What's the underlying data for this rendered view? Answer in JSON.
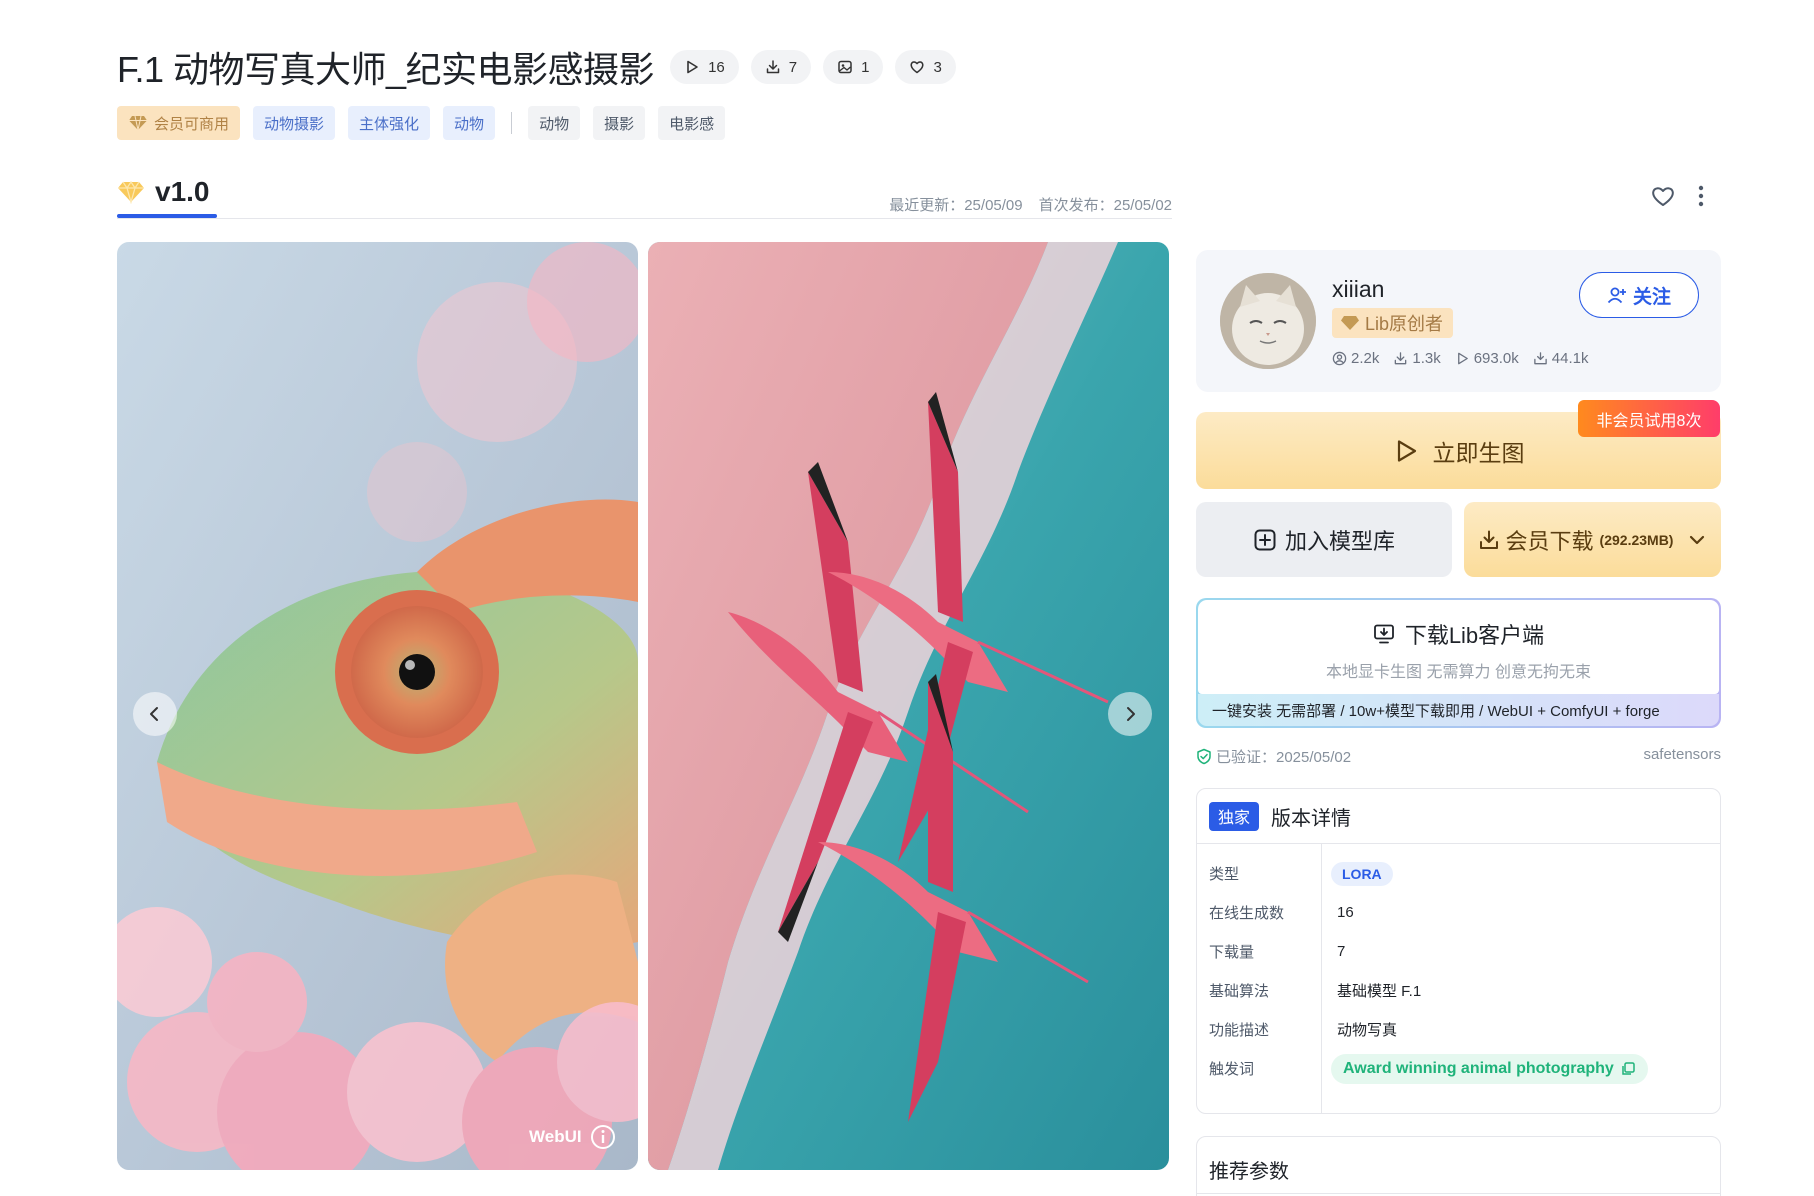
{
  "model": {
    "title": "F.1 动物写真大师_纪实电影感摄影",
    "stats": {
      "runs": "16",
      "downloads": "7",
      "images": "1",
      "likes": "3"
    }
  },
  "tags": {
    "member": "会员可商用",
    "primary": [
      "动物摄影",
      "主体强化",
      "动物"
    ],
    "secondary": [
      "动物",
      "摄影",
      "电影感"
    ]
  },
  "version": {
    "label": "v1.0",
    "updated": "最近更新：25/05/09",
    "published": "首次发布：25/05/02"
  },
  "gallery": {
    "badge": "WebUI"
  },
  "author": {
    "name": "xiiian",
    "badge": "Lib原创者",
    "followers": "2.2k",
    "downloads": "1.3k",
    "runs": "693.0k",
    "total_downloads": "44.1k",
    "follow_label": "关注"
  },
  "actions": {
    "generate_label": "立即生图",
    "trial_badge": "非会员试用8次",
    "add_library_label": "加入模型库",
    "download_label": "会员下载",
    "download_size": "(292.23MB)"
  },
  "client": {
    "title": "下载Lib客户端",
    "subtitle": "本地显卡生图 无需算力 创意无拘无束",
    "footer": "一键安装 无需部署 / 10w+模型下载即用 / WebUI + ComfyUI + forge"
  },
  "verify": {
    "label": "已验证：2025/05/02",
    "format": "safetensors"
  },
  "details": {
    "badge": "独家",
    "title": "版本详情",
    "rows": [
      {
        "key": "类型",
        "value": "LORA"
      },
      {
        "key": "在线生成数",
        "value": "16"
      },
      {
        "key": "下载量",
        "value": "7"
      },
      {
        "key": "基础算法",
        "value": "基础模型 F.1"
      },
      {
        "key": "功能描述",
        "value": "动物写真"
      },
      {
        "key": "触发词",
        "value": "Award winning animal photography"
      }
    ]
  },
  "params": {
    "title": "推荐参数"
  },
  "colors": {
    "accent": "#2b5ce6",
    "gold": "#fbdc9a",
    "trigger_green": "#1fb37a"
  }
}
